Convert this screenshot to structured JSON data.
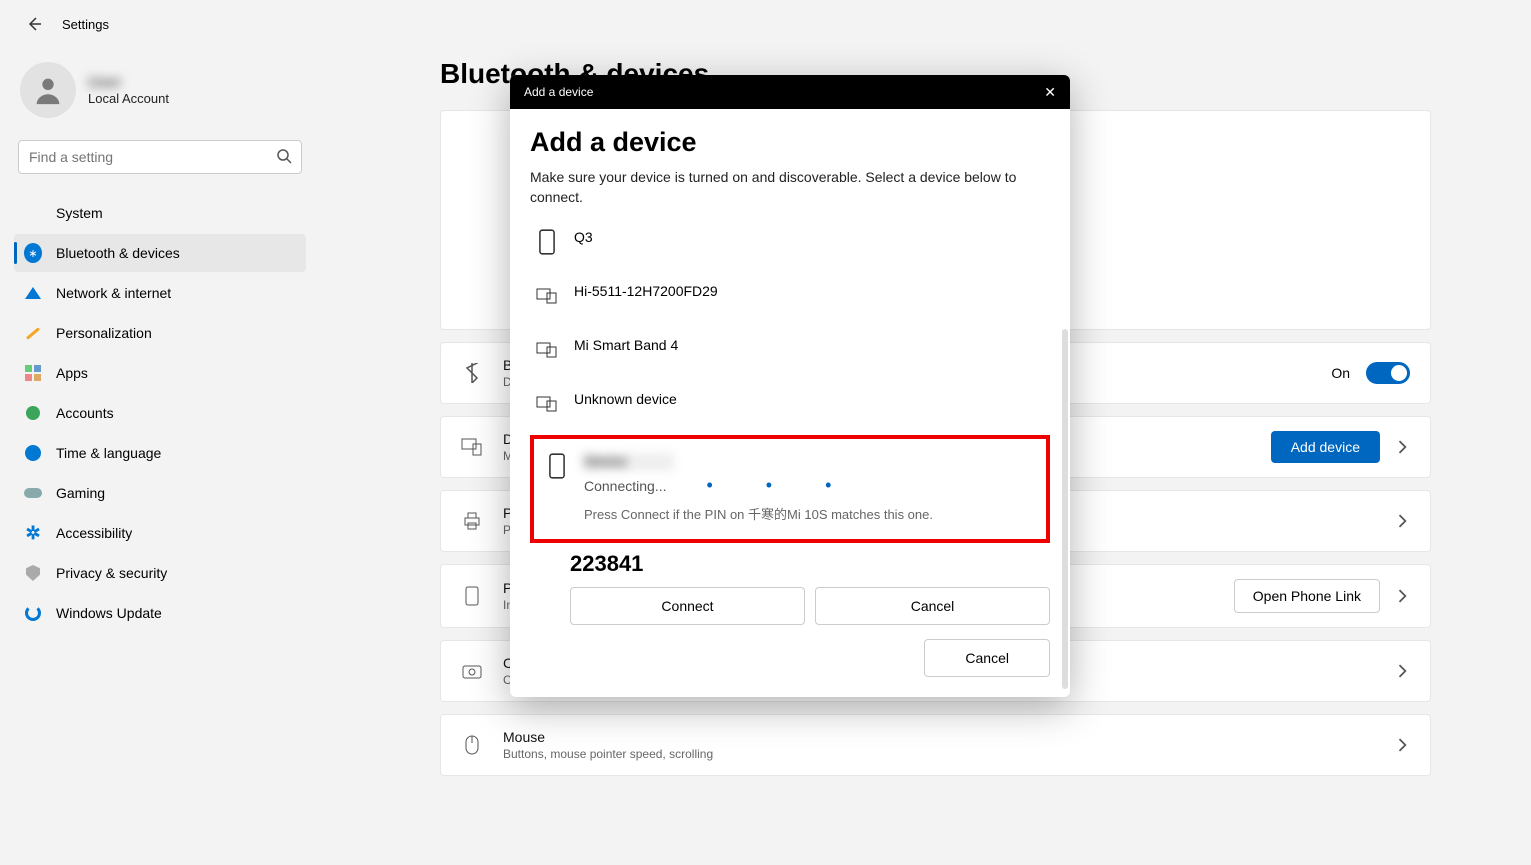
{
  "header": {
    "title": "Settings"
  },
  "account": {
    "name": "User",
    "type": "Local Account"
  },
  "search": {
    "placeholder": "Find a setting"
  },
  "sidebar": {
    "items": [
      {
        "label": "System"
      },
      {
        "label": "Bluetooth & devices"
      },
      {
        "label": "Network & internet"
      },
      {
        "label": "Personalization"
      },
      {
        "label": "Apps"
      },
      {
        "label": "Accounts"
      },
      {
        "label": "Time & language"
      },
      {
        "label": "Gaming"
      },
      {
        "label": "Accessibility"
      },
      {
        "label": "Privacy & security"
      },
      {
        "label": "Windows Update"
      }
    ]
  },
  "page": {
    "title": "Bluetooth & devices"
  },
  "rows": {
    "bluetooth": {
      "title": "Bluetooth",
      "sub": "Discoverable",
      "toggle_label": "On"
    },
    "devices": {
      "title": "Devices",
      "sub": "Mouse, keyboard, pen, audio, displays and docks, other devices",
      "button": "Add device"
    },
    "printers": {
      "title": "Printers & scanners",
      "sub": "Preferences, troubleshoot"
    },
    "phone": {
      "title": "Phone Link",
      "sub": "Instantly access your Android or iPhone from your PC",
      "button": "Open Phone Link"
    },
    "cameras": {
      "title": "Cameras",
      "sub": "Connected cameras, default image settings"
    },
    "mouse": {
      "title": "Mouse",
      "sub": "Buttons, mouse pointer speed, scrolling"
    }
  },
  "modal": {
    "titlebar": "Add a device",
    "heading": "Add a device",
    "description": "Make sure your device is turned on and discoverable. Select a device below to connect.",
    "devices": [
      {
        "label": "Q3"
      },
      {
        "label": "Hi-5511-12H7200FD29"
      },
      {
        "label": "Mi Smart Band 4"
      },
      {
        "label": "Unknown device"
      }
    ],
    "connecting": {
      "name": "Device",
      "status": "Connecting...",
      "hint": "Press Connect if the PIN on 千寒的Mi 10S matches this one.",
      "pin": "223841",
      "connect": "Connect",
      "cancel": "Cancel"
    },
    "footer_cancel": "Cancel"
  }
}
